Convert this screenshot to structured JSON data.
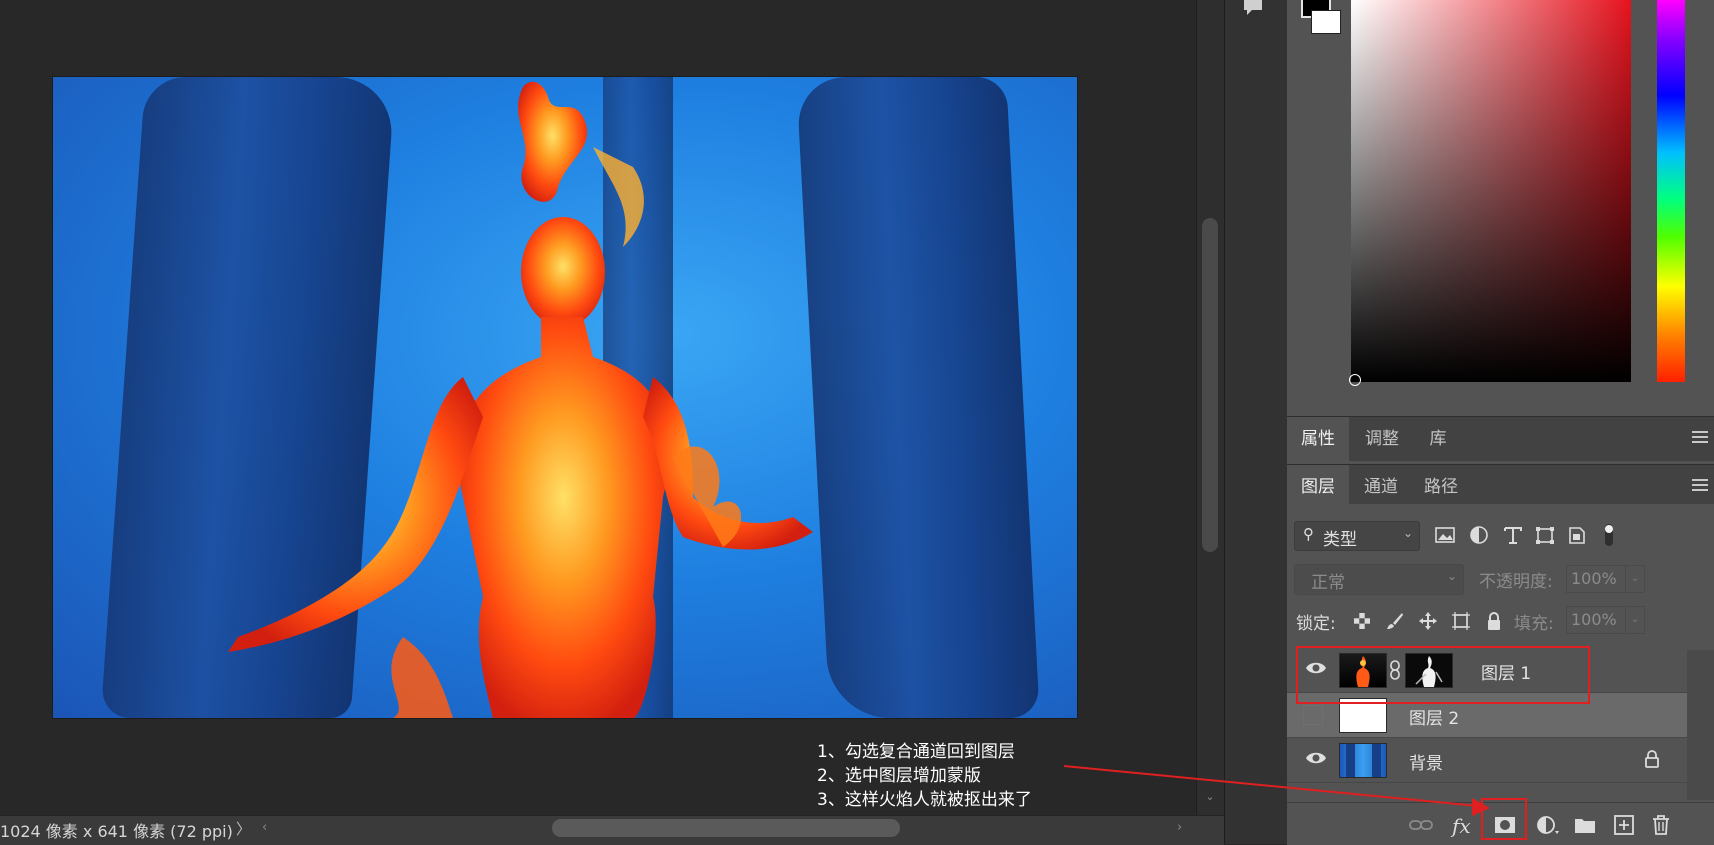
{
  "status_bar": {
    "doc_info": "1024 像素 x 641 像素 (72 ppi)",
    "arrow": "〉"
  },
  "canvas": {
    "image_subject": "flaming-woman-underwater"
  },
  "panels": {
    "top_tabs": [
      "属性",
      "调整",
      "库"
    ],
    "layer_tabs": [
      "图层",
      "通道",
      "路径"
    ]
  },
  "layers_panel": {
    "filter_label": "类型",
    "blend_mode": "正常",
    "opacity_label": "不透明度:",
    "opacity_value": "100%",
    "lock_label": "锁定:",
    "fill_label": "填充:",
    "fill_value": "100%",
    "layers": [
      {
        "name": "图层 1",
        "visible": true,
        "selected": false,
        "has_mask": true
      },
      {
        "name": "图层 2",
        "visible": false,
        "selected": true,
        "has_mask": false
      },
      {
        "name": "背景",
        "visible": true,
        "selected": false,
        "locked": true
      }
    ]
  },
  "annotation": {
    "lines": [
      "1、勾选复合通道回到图层",
      "2、选中图层增加蒙版",
      "3、这样火焰人就被抠出来了"
    ]
  },
  "colors": {
    "foreground": "#000000",
    "background": "#ffffff",
    "hue": "#e6131e",
    "highlight": "#e02020"
  }
}
